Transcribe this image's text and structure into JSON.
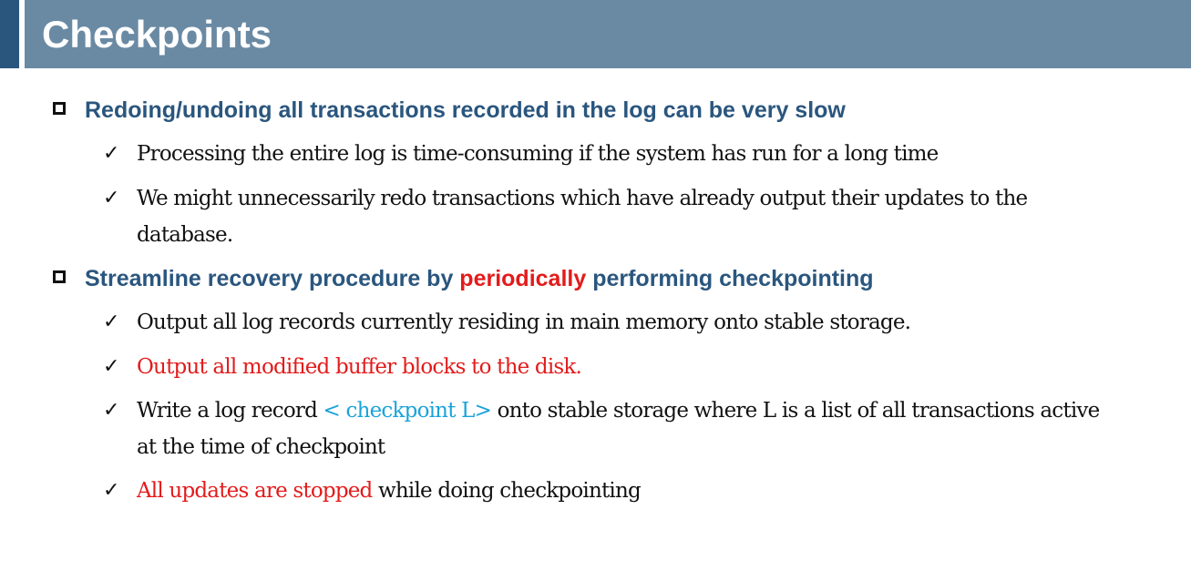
{
  "slide": {
    "title": "Checkpoints",
    "sections": [
      {
        "heading_parts": [
          "Redoing/undoing all transactions recorded in the log can be very slow"
        ],
        "items": [
          {
            "parts": [
              "Processing the entire log is time-consuming if the system has run for a long time"
            ]
          },
          {
            "parts": [
              "We might unnecessarily redo transactions which have already output their updates to the database."
            ]
          }
        ]
      },
      {
        "heading_parts": [
          "Streamline recovery procedure by ",
          "periodically",
          " performing checkpointing"
        ],
        "items": [
          {
            "parts": [
              "Output all log records currently residing in main memory onto stable storage."
            ]
          },
          {
            "parts": [
              "Output all modified buffer blocks to the disk."
            ]
          },
          {
            "parts": [
              "Write a log record ",
              "< checkpoint L>",
              " onto stable storage where L is a list of all transactions active at the time of checkpoint"
            ]
          },
          {
            "parts": [
              "All updates are stopped",
              " while doing checkpointing"
            ]
          }
        ]
      }
    ]
  },
  "icons": {
    "section_bullet": "square-outline-icon",
    "item_bullet": "checkmark-icon",
    "checkmark_glyph": "✓"
  },
  "colors": {
    "header_bar": "#6a8aa4",
    "header_accent": "#2a567e",
    "heading_text": "#2a567e",
    "emphasis_red": "#e31b1b",
    "emphasis_cyan": "#1aa3d9"
  }
}
